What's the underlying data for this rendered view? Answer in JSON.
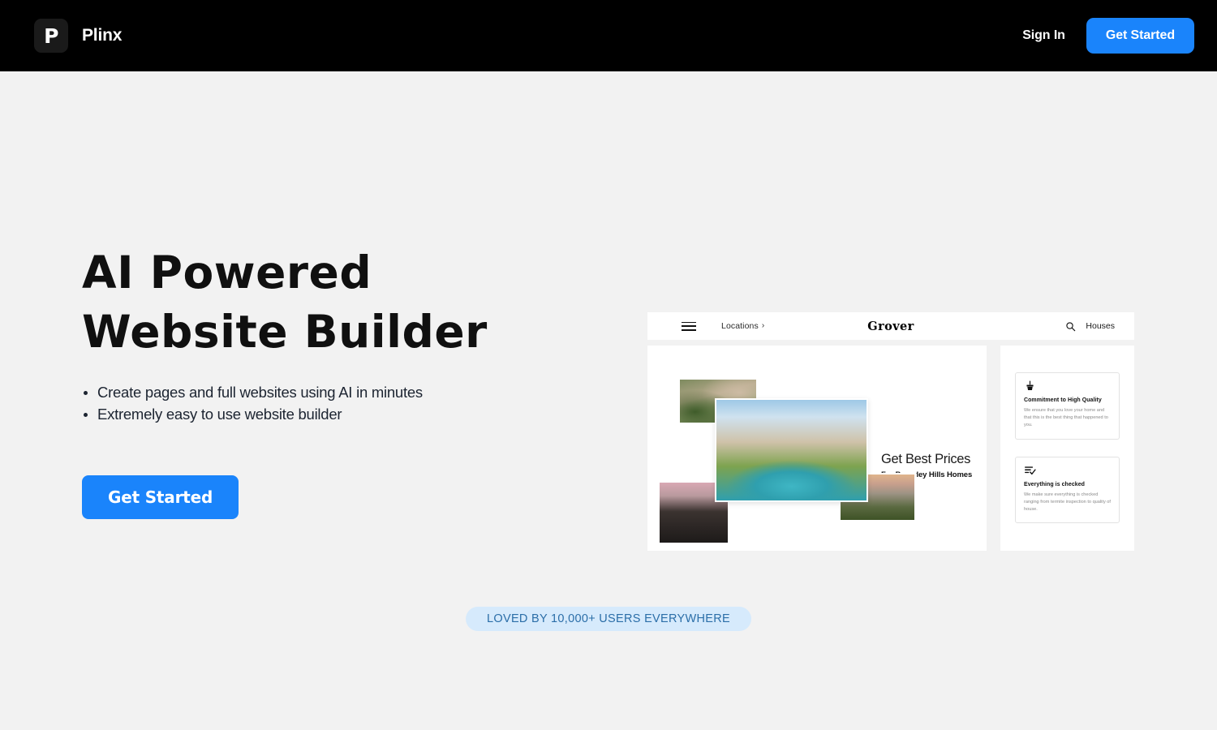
{
  "header": {
    "logo_letter": "P",
    "brand_name": "Plinx",
    "sign_in_label": "Sign In",
    "get_started_label": "Get Started",
    "background_color": "#000000",
    "accent_color": "#1a84fb"
  },
  "hero": {
    "title_line_1": "AI Powered",
    "title_line_2": "Website Builder",
    "bullets": [
      "Create pages and full websites using AI in minutes",
      "Extremely easy to use website builder"
    ],
    "cta_label": "Get Started"
  },
  "mockup": {
    "nav": {
      "menu_icon": "hamburger-icon",
      "locations_label": "Locations",
      "locations_chevron": "›",
      "brand": "Grover",
      "search_icon": "search-icon",
      "houses_label": "Houses"
    },
    "main": {
      "headline": "Get Best Prices",
      "subheadline": "For Beverley Hills Homes",
      "photos": [
        "aerial-hillside-estates",
        "luxury-villa-with-pool",
        "modern-house-at-dusk",
        "coastal-mansion-at-sunset"
      ]
    },
    "cards": [
      {
        "icon": "brush-icon",
        "title": "Commitment to High Quality",
        "text": "We ensure that you love your home and that this is the best thing that happened to you."
      },
      {
        "icon": "checklist-icon",
        "title": "Everything is checked",
        "text": "We make sure everything is checked ranging from termite inspection to quality of house."
      }
    ]
  },
  "social_proof": {
    "badge_text": "LOVED BY 10,000+ USERS EVERYWHERE",
    "badge_background": "#d6eafc",
    "badge_text_color": "#2b6ea8"
  }
}
